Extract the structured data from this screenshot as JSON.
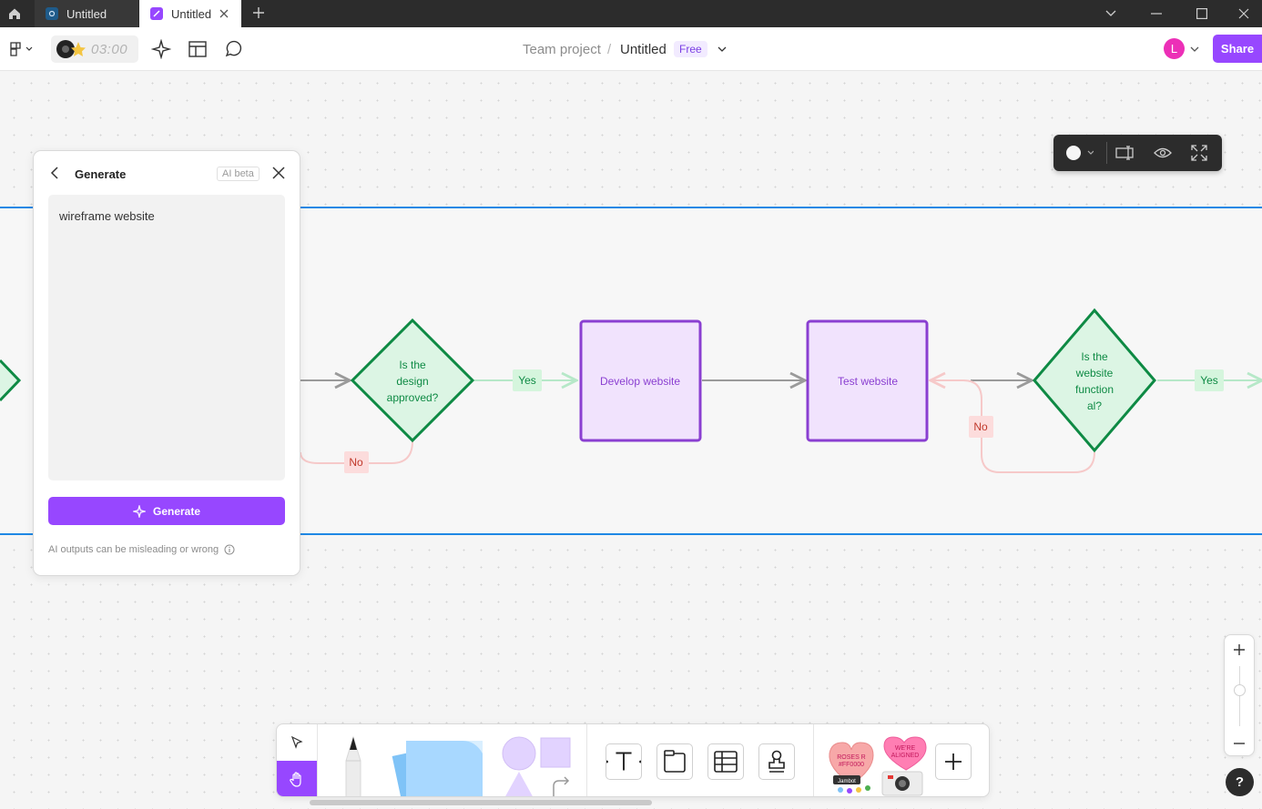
{
  "window": {
    "tabs": [
      {
        "label": "Untitled"
      },
      {
        "label": "Untitled"
      }
    ]
  },
  "toolbar": {
    "timer": "03:00",
    "breadcrumb_team": "Team project",
    "breadcrumb_sep": "/",
    "file_name": "Untitled",
    "plan_badge": "Free",
    "avatar_initial": "L",
    "share_label": "Share"
  },
  "generate_panel": {
    "title": "Generate",
    "beta_badge": "AI beta",
    "prompt_text": "wireframe website",
    "button_label": "Generate",
    "disclaimer": "AI outputs can be misleading or wrong"
  },
  "flowchart": {
    "decision_1": [
      "Is the",
      "design",
      "approved?"
    ],
    "process_1": "Develop website",
    "process_2": "Test website",
    "decision_2": [
      "Is the",
      "website",
      "function",
      "al?"
    ],
    "labels": {
      "yes": "Yes",
      "no": "No"
    }
  },
  "stickers": {
    "heart_1": [
      "ROSES R",
      "#FF0000"
    ],
    "heart_1_tag": "Jambot",
    "heart_2": [
      "WE'RE",
      "ALIGNED"
    ]
  },
  "help_label": "?",
  "colors": {
    "accent": "#9747ff",
    "section_border": "#1e88e5",
    "decision_green": "#0e8a44",
    "process_purple": "#8a3fd1"
  }
}
